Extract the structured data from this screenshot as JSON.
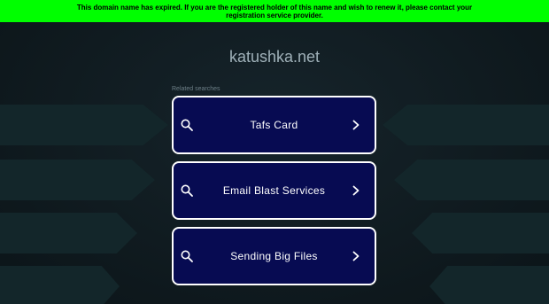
{
  "banner": {
    "text": "This domain name has expired. If you are the registered holder of this name and wish to renew it, please contact your registration service provider."
  },
  "domain": "katushka.net",
  "related_label": "Related searches",
  "results": [
    {
      "label": "Tafs Card"
    },
    {
      "label": "Email Blast Services"
    },
    {
      "label": "Sending Big Files"
    }
  ],
  "colors": {
    "banner_bg": "#00ff00",
    "card_bg": "#070b52",
    "card_border": "#ffffff",
    "page_bg": "#0f1a1f"
  }
}
